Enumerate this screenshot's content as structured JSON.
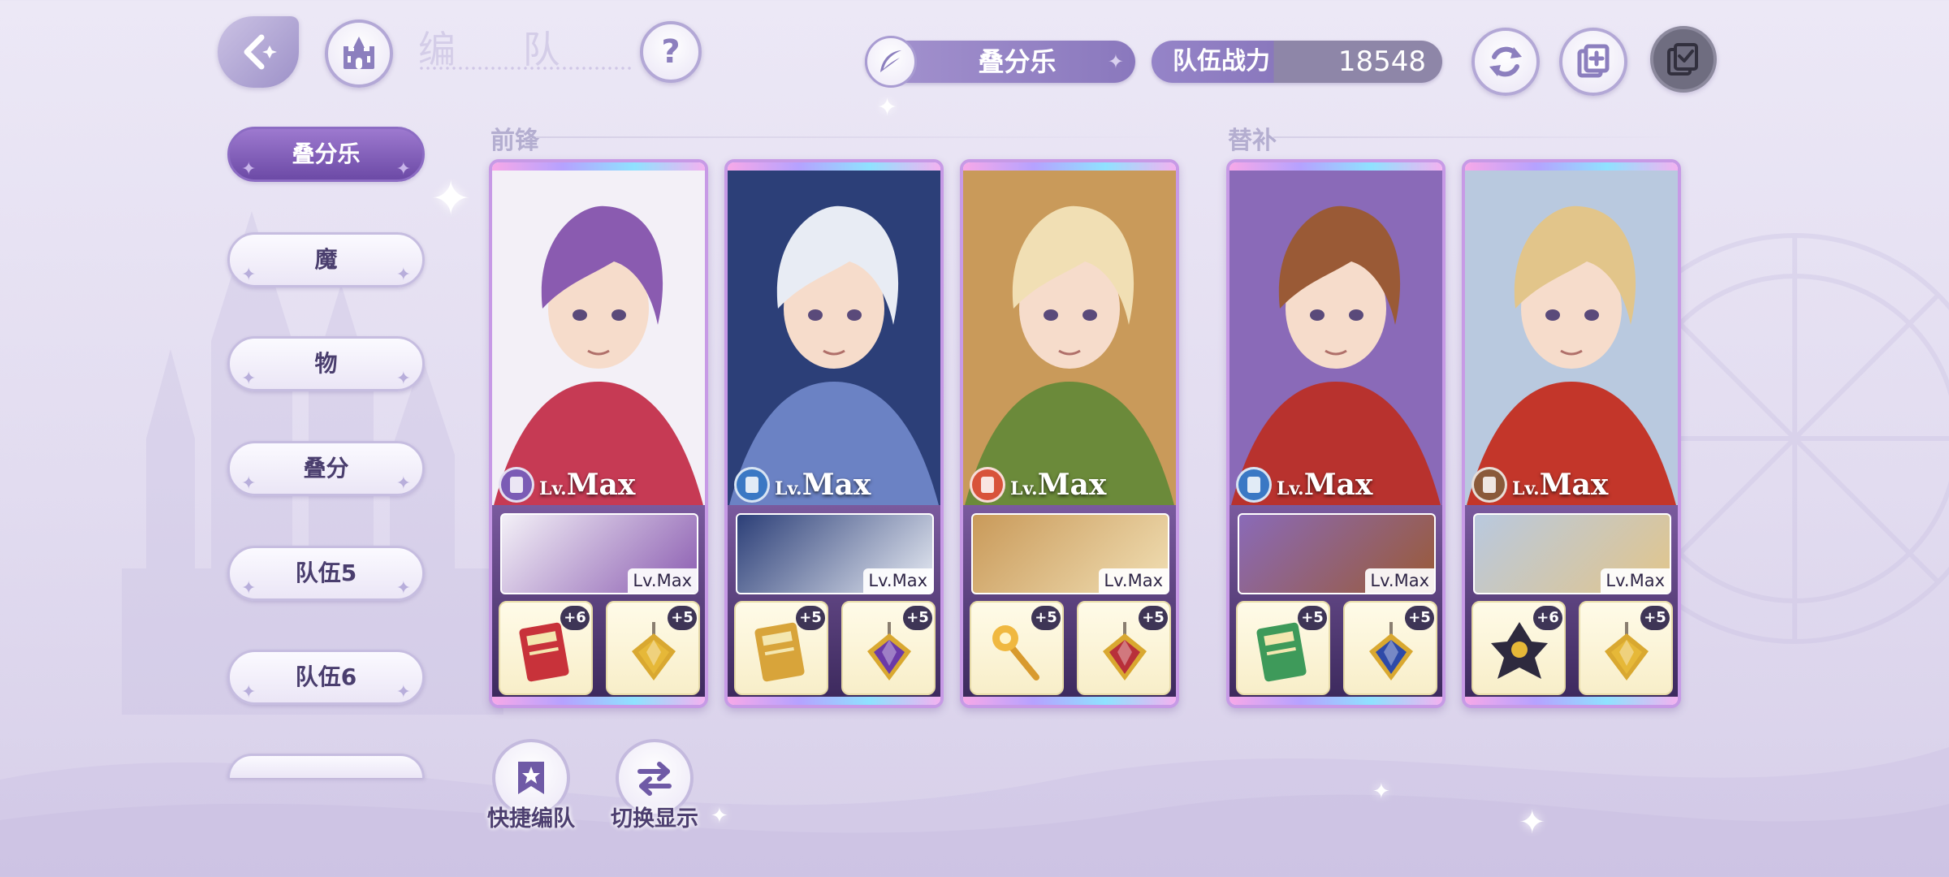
{
  "header": {
    "title": "编 队",
    "team_name": "叠分乐",
    "power_label": "队伍战力",
    "power_value": "18548"
  },
  "icons": {
    "back": "back-chevron-icon",
    "home": "castle-home-icon",
    "help": "question-icon",
    "team_name": "feather-icon",
    "refresh": "refresh-icon",
    "copy": "copy-plus-icon",
    "confirm": "checklist-icon",
    "quick_team": "bookmark-star-icon",
    "switch_display": "swap-arrows-icon"
  },
  "sidebar": {
    "tabs": [
      {
        "label": "叠分乐",
        "active": true
      },
      {
        "label": "魔",
        "active": false
      },
      {
        "label": "物",
        "active": false
      },
      {
        "label": "叠分",
        "active": false
      },
      {
        "label": "队伍5",
        "active": false
      },
      {
        "label": "队伍6",
        "active": false
      },
      {
        "label": "",
        "active": false
      }
    ]
  },
  "sections": {
    "front": "前锋",
    "sub": "替补"
  },
  "cards": [
    {
      "attribute_color": "#7b5bb5",
      "lv_prefix": "Lv.",
      "lv_value": "Max",
      "sub_lv": "Lv.Max",
      "equip": [
        {
          "plus": "+6",
          "item": "red-book-icon"
        },
        {
          "plus": "+5",
          "item": "gold-gem-pendant-icon"
        }
      ],
      "palette": {
        "hair": "#8a5bb0",
        "bg": "#f3f0f7",
        "accent": "#c63a54"
      }
    },
    {
      "attribute_color": "#3a78c4",
      "lv_prefix": "Lv.",
      "lv_value": "Max",
      "sub_lv": "Lv.Max",
      "equip": [
        {
          "plus": "+5",
          "item": "gold-book-icon"
        },
        {
          "plus": "+5",
          "item": "purple-gem-pendant-icon"
        }
      ],
      "palette": {
        "hair": "#e8ecf4",
        "bg": "#2c3f78",
        "accent": "#6b82c4"
      }
    },
    {
      "attribute_color": "#d8533a",
      "lv_prefix": "Lv.",
      "lv_value": "Max",
      "sub_lv": "Lv.Max",
      "equip": [
        {
          "plus": "+5",
          "item": "gold-scepter-icon"
        },
        {
          "plus": "+5",
          "item": "red-gem-pendant-icon"
        }
      ],
      "palette": {
        "hair": "#f1dfb4",
        "bg": "#c99a5a",
        "accent": "#6b8a3a"
      }
    },
    {
      "attribute_color": "#3a78c4",
      "lv_prefix": "Lv.",
      "lv_value": "Max",
      "sub_lv": "Lv.Max",
      "equip": [
        {
          "plus": "+5",
          "item": "green-book-icon"
        },
        {
          "plus": "+5",
          "item": "blue-gem-pendant-icon"
        }
      ],
      "palette": {
        "hair": "#9a5a36",
        "bg": "#8a6ab8",
        "accent": "#b8322e"
      }
    },
    {
      "attribute_color": "#8a5a3a",
      "lv_prefix": "Lv.",
      "lv_value": "Max",
      "sub_lv": "Lv.Max",
      "equip": [
        {
          "plus": "+6",
          "item": "dark-crest-icon"
        },
        {
          "plus": "+5",
          "item": "gold-gem-pendant-icon"
        }
      ],
      "palette": {
        "hair": "#e2c58a",
        "bg": "#b9c9df",
        "accent": "#c3362a"
      }
    }
  ],
  "actions": {
    "quick_team": "快捷编队",
    "switch_display": "切换显示"
  }
}
